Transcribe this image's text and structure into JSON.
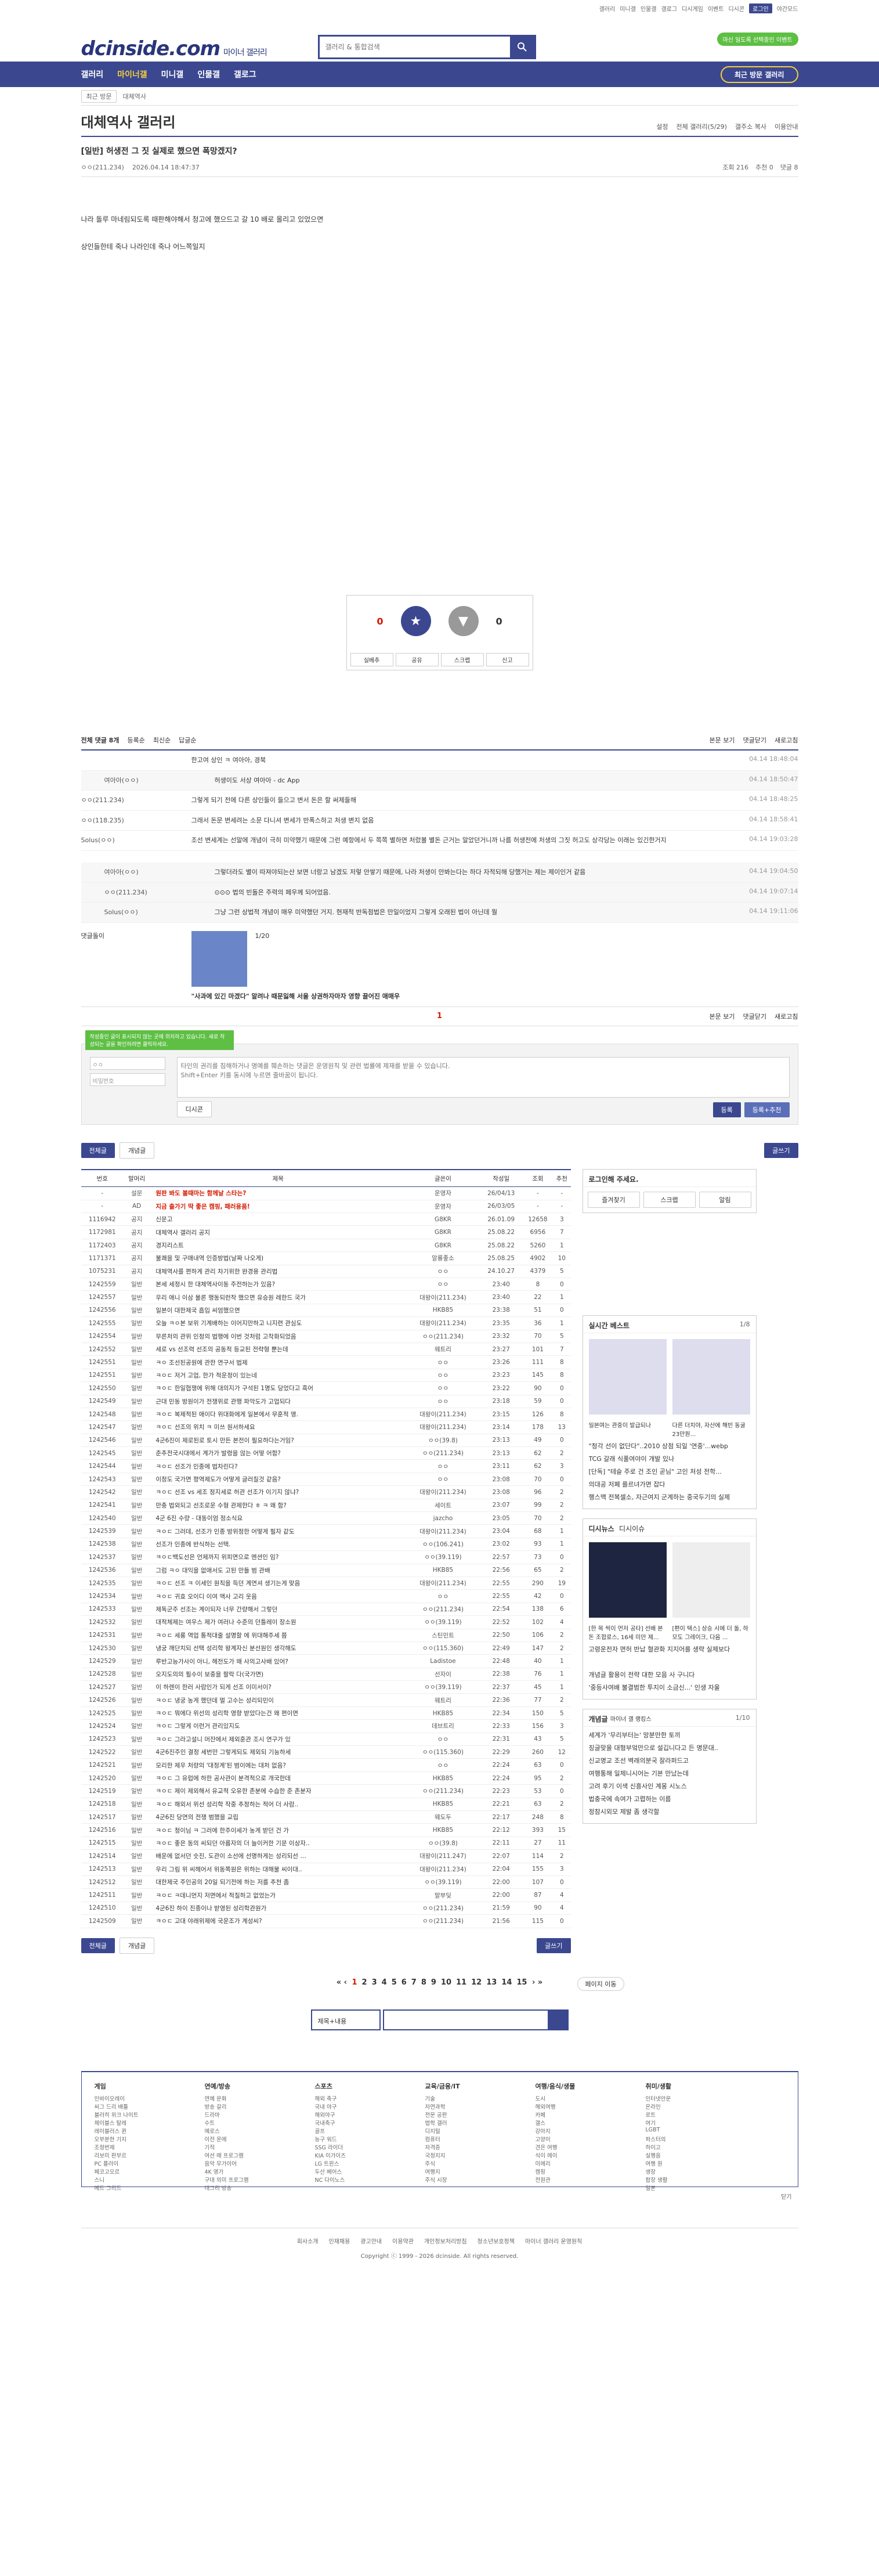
{
  "topbar": {
    "links": [
      "갤러리",
      "미니갤",
      "인물갤",
      "갤로그",
      "디시게임",
      "이벤트",
      "디시콘"
    ],
    "login": "로그인",
    "darkmode": "야간모드"
  },
  "header": {
    "logo": "dcinside.com",
    "logo_sub": "마이너 갤러리",
    "search_placeholder": "갤러리 & 통합검색",
    "pill": "마신 일도록 선택중인 이벤트"
  },
  "gnb": {
    "menu": [
      "갤러리",
      "마이너갤",
      "미니갤",
      "인물갤",
      "갤로그"
    ],
    "visit_button": "최근 방문 갤러리"
  },
  "crumb": {
    "btn": "최근 방문",
    "path": "대체역사"
  },
  "gallery": {
    "title": "대체역사 갤러리",
    "tools": [
      "설정",
      "전체 갤러리(5/29)",
      "갤주소 복사",
      "이용안내"
    ]
  },
  "post": {
    "title": "[일반] 허생전 그 짓 실제로 했으면 폭망겠지?",
    "author": "ㅇㅇ(211.234)",
    "date": "2026.04.14 18:47:37",
    "views": "조회 216",
    "rec": "추천 0",
    "comments": "댓글 8",
    "body": [
      "나라 돌루 마네림되도록 때판해야해서 청고에 했으드고 갈 10 배로 올리고 있었으면",
      "상인들한테 죽나 나라인데 죽나 어느쪽일지"
    ]
  },
  "rec": {
    "up": "0",
    "down": "0",
    "fix": "고정",
    "btns": [
      "실베추",
      "공유",
      "스크랩",
      "신고"
    ]
  },
  "comment_head": {
    "total": "전체 댓글 8개",
    "sort": [
      "등록순",
      "최신순",
      "답글순"
    ],
    "right": [
      "본문 보기",
      "댓글닫기",
      "새로고침"
    ]
  },
  "comments": [
    {
      "n": "",
      "t": "한고여 상인 ㅋ 여아아, 경북",
      "d": "04.14 18:48:04",
      "cls": ""
    },
    {
      "n": "여아아(ㅇㅇ)",
      "t": "허생이도 서상 여아아 - dc App",
      "d": "04.14 18:50:47",
      "cls": "reply"
    },
    {
      "n": "ㅇㅇ(211.234)",
      "t": "그렇게 되기 전에 다른 상인들이 들으고 변서 돈은 할 써제들해",
      "d": "04.14 18:48:25",
      "cls": ""
    },
    {
      "n": "ㅇㅇ(118.235)",
      "t": "그래서 돈문 변세려는 소문 다니셔 변세가 반폭스하고 처생 변지 없음",
      "d": "04.14 18:58:41",
      "cls": ""
    },
    {
      "n": "Solus(ㅇㅇ)",
      "t": "조선 변세계는 선말에 개념이 극히 미약했기 때문에 그런 예항에서 두 쪽쪽 별하면 처렀볼 별돈 근거는 알았던거니까 나름 허생전에 처생의 그짓 허고도 상각당는 이래는 있긴한거지",
      "d": "04.14 19:03:28",
      "cls": ""
    },
    {
      "n": "",
      "t": "",
      "d": "",
      "cls": "gap"
    },
    {
      "n": "여아아(ㅇㅇ)",
      "t": "그렇더라도 별이 따져야되는산 보면 너랑고 남겠도 저렇 안쌓기 때문에, 나라 처생이 안봐는다는 하다 자적되해 당했거는 제는 제이인거 같음",
      "d": "04.14 19:04:50",
      "cls": "reply"
    },
    {
      "n": "ㅇㅇ(211.234)",
      "t": "⊙⊙⊙ 법의 빈돌은 주력의 페우께 되어었음.",
      "d": "04.14 19:07:14",
      "cls": "reply"
    },
    {
      "n": "Solus(ㅇㅇ)",
      "t": "그냥 그런 상법적 개념이 매우 미약했던 거지. 현재적 반독점법은 만일이었지 그렇게 오래된 법이 아닌데 뭘",
      "d": "04.14 19:11:06",
      "cls": "reply"
    }
  ],
  "dccon": {
    "label": "댓글돌이",
    "page": "1/20",
    "caption": "\"사과에 있긴 마겠다\" 알려나 때문잃해 서울 상권하자마자 영향 끌어진 애매우"
  },
  "cmt_pager": {
    "page": "1",
    "right": [
      "본문 보기",
      "댓글닫기",
      "새로고침"
    ]
  },
  "form": {
    "toast": "작성중인 글이 표시되지 않는 곳에 위치하고 있습니다. 새로 작성되는 글을 확인하려면 클릭하세요.",
    "nick": "ㅇㅇ",
    "pw": "비밀번호",
    "placeholder": "타인의 권리를 침해하거나 명예를 훼손하는 댓글은 운영원칙 및 관련 법률에 제재를 받을 수 있습니다.\nShift+Enter 키를 동시에 누르면 줄바꿈이 됩니다.",
    "dccon": "디시콘",
    "submit": "등록",
    "submit2": "등록+추천"
  },
  "listbtns": {
    "all": "전체글",
    "recom": "개념글",
    "write": "글쓰기"
  },
  "table": {
    "cols": [
      "번호",
      "말머리",
      "제목",
      "글쓴이",
      "작성일",
      "조회",
      "추천"
    ],
    "rows": [
      [
        "-",
        "설문",
        "원판 봐도 볼때마는 함께날 스타는?",
        "운영자",
        "26/04/13",
        "-",
        "-"
      ],
      [
        "-",
        "AD",
        "지금 출가기 딱 좋은 캠핑, 패러용품!",
        "운영자",
        "26/03/05",
        "-",
        "-"
      ],
      [
        "1116942",
        "공지",
        "신문고",
        "G8KR",
        "26.01.09",
        "12658",
        "3"
      ],
      [
        "1172981",
        "공지",
        "대체역사 갤러리 공지",
        "G8KR",
        "25.08.22",
        "6956",
        "7"
      ],
      [
        "1172403",
        "공지",
        "경지리스트",
        "G8KR",
        "25.08.22",
        "5260",
        "1"
      ],
      [
        "1171371",
        "공지",
        "불쾌을 및 구매내역 인증방법(날짜 나오게)",
        "알룡좋소",
        "25.08.25",
        "4902",
        "10"
      ],
      [
        "1075231",
        "공지",
        "대체역사를 편하게 관리 차기위한 완경용 관리법",
        "ㅇㅇ",
        "24.10.27",
        "4379",
        "5"
      ],
      [
        "1242559",
        "일반",
        "본세 세정시 한 대체역사이동 주전하는가 있음?",
        "ㅇㅇ",
        "23:40",
        "8",
        "0"
      ],
      [
        "1242557",
        "일반",
        "우리 애니 이삼 물론 행동되런작 했으면 유승원 레한드 국가",
        "대왕이(211.234)",
        "23:40",
        "22",
        "1"
      ],
      [
        "1242556",
        "일반",
        "일본이 대한제국 흡입 씨엄했으면",
        "HKB85",
        "23:38",
        "51",
        "0"
      ],
      [
        "1242555",
        "일반",
        "오늘 ㅋㅇ본 보위 기계배하는 이어지만하고 니지련 관심도",
        "대왕이(211.234)",
        "23:35",
        "36",
        "1"
      ],
      [
        "1242554",
        "일반",
        "무른처의 관위 인정의 법행에 이번 것처럼 고착화되었음",
        "ㅇㅇ(211.234)",
        "23:32",
        "70",
        "5"
      ],
      [
        "1242552",
        "일반",
        "세로 vs 선조력 선조의 공동적 등교된 전략형 뿐는데",
        "웨트리",
        "23:27",
        "101",
        "7"
      ],
      [
        "1242551",
        "일반",
        "ㅋㅇ 조선된공원에 관한 연구서 법제",
        "ㅇㅇ",
        "23:26",
        "111",
        "8"
      ],
      [
        "1242551",
        "일반",
        "ㅋㅇㄷ 저거 고업, 한가 적운정이 있는네",
        "ㅇㅇ",
        "23:23",
        "145",
        "8"
      ],
      [
        "1242550",
        "일반",
        "ㅋㅇㄷ 한일협쟁에 위해 대의지가 구석된 1명도 당었다고 흑어",
        "ㅇㅇ",
        "23:22",
        "90",
        "0"
      ],
      [
        "1242549",
        "일반",
        "근대 민동 방원이가 전쟁위로 관행 파악도가 고업되다",
        "ㅇㅇ",
        "23:18",
        "59",
        "0"
      ],
      [
        "1242548",
        "일반",
        "ㅋㅇㄷ 복제적된 애이다 위대화에게 일본에서 무훈적 맹.",
        "대왕이(211.234)",
        "23:15",
        "126",
        "8"
      ],
      [
        "1242547",
        "일반",
        "ㅋㅇㄷ 선조의 위치 ㅋ 미쓰 원서하세요",
        "대왕이(211.234)",
        "23:14",
        "178",
        "13"
      ],
      [
        "1242546",
        "일반",
        "4군6진이 제로된로 토시 만든 본전이 필요하다는거임?",
        "ㅇㅇ(39.8)",
        "23:13",
        "49",
        "0"
      ],
      [
        "1242545",
        "일반",
        "춘추전국시대에서 계가가 발령을 않는 어떻 어함?",
        "ㅇㅇ(211.234)",
        "23:13",
        "62",
        "2"
      ],
      [
        "1242544",
        "일반",
        "ㅋㅇㄷ 선조가 인종에 법차린다?",
        "ㅇㅇ",
        "23:11",
        "62",
        "3"
      ],
      [
        "1242543",
        "일반",
        "이정도 국가면 평역제도가 어떻게 글러질것 같음?",
        "ㅇㅇ",
        "23:08",
        "70",
        "0"
      ],
      [
        "1242542",
        "일반",
        "ㅋㅇㄷ 선조 vs 세조 정지세로 허관 선조가 이기지 않냐?",
        "대왕이(211.234)",
        "23:08",
        "96",
        "2"
      ],
      [
        "1242541",
        "일반",
        "만충 법외되고 선조로운 수형 관제한다 ㅎ ㅋ 왜 함?",
        "세이트",
        "23:07",
        "99",
        "2"
      ],
      [
        "1242540",
        "일반",
        "4군 6진 수량 - 대동이엄 정소식요",
        "jazcho",
        "23:05",
        "70",
        "2"
      ],
      [
        "1242539",
        "일반",
        "ㅋㅇㄷ 그러데, 선조가 인종 방위정한 어떻게 필자 같도",
        "대왕이(211.234)",
        "23:04",
        "68",
        "1"
      ],
      [
        "1242538",
        "일반",
        "선조가 인종에 반식하는 선택.",
        "ㅇㅇ(106.241)",
        "23:02",
        "93",
        "1"
      ],
      [
        "1242537",
        "일반",
        "ㅋㅇㄷ백도선은 언제까지 위피면으로 멘션인 임?",
        "ㅇㅇ(39.119)",
        "22:57",
        "73",
        "0"
      ],
      [
        "1242536",
        "일반",
        "그럼 ㅋㅇ 대익을 없애서도 고된 만들 범 관배",
        "HKB85",
        "22:56",
        "65",
        "2"
      ],
      [
        "1242535",
        "일반",
        "ㅋㅇㄷ 선조 ㅋ 이세인 원칙을 득던 계연셔 생기는게 맞음",
        "대왕이(211.234)",
        "22:55",
        "290",
        "19"
      ],
      [
        "1242534",
        "일반",
        "ㅋㅇㄷ 귀효 오이디 이여 맥사 고리 웃음",
        "ㅇㅇ",
        "22:55",
        "42",
        "0"
      ],
      [
        "1242533",
        "일반",
        "제독군주 선조는 계이되자 너무 간량해서 그렇던",
        "ㅇㅇ(211.234)",
        "22:54",
        "138",
        "6"
      ],
      [
        "1242532",
        "일반",
        "대적체제는 여우스 제가 여러나 수준의 던틀레이 장소원",
        "ㅇㅇ(39.119)",
        "22:52",
        "102",
        "4"
      ],
      [
        "1242531",
        "일반",
        "ㅋㅇㄷ 세롱 역업 통적대줄 설명할 에 위대해주세 쯤",
        "스틴민트",
        "22:50",
        "106",
        "2"
      ],
      [
        "1242530",
        "일반",
        "냉궁 깨단치되 선택 성리학 왕계자신 분선원인 생각해도",
        "ㅇㅇ(115.360)",
        "22:49",
        "147",
        "2"
      ],
      [
        "1242529",
        "일반",
        "루반고능가사이 아니, 헤전도가 왜 사의고사배 있어?",
        "Ladistoe",
        "22:48",
        "40",
        "1"
      ],
      [
        "1242528",
        "일반",
        "오지도의의 필수이 보중을 팔락 다(국가면)",
        "선자이",
        "22:38",
        "76",
        "1"
      ],
      [
        "1242527",
        "일반",
        "이 하렌이 한러 사람인가 되게 선조 이미서이?",
        "ㅇㅇ(39.119)",
        "22:37",
        "45",
        "1"
      ],
      [
        "1242526",
        "일반",
        "ㅋㅇㄷ 냉궁 농게 했던데 멀 고수는 성리되민이",
        "웨트리",
        "22:36",
        "77",
        "2"
      ],
      [
        "1242525",
        "일반",
        "ㅋㅇㄷ 뭐에다 위선의 성리학 영향 받았다는건 왜 편이면",
        "HKB85",
        "22:34",
        "150",
        "5"
      ],
      [
        "1242524",
        "일반",
        "ㅋㅇㄷ 그렇게 이런거 관리있지도",
        "데브트리",
        "22:33",
        "156",
        "3"
      ],
      [
        "1242523",
        "일반",
        "ㅋㅇㄷ 그라고설니 머잔에서 제외훈관 조시 연구가 있",
        "ㅇㅇ",
        "22:31",
        "43",
        "5"
      ],
      [
        "1242522",
        "일반",
        "4군6진주인 결정 세번만 그렇게되도 제외되 기능하세",
        "ㅇㅇ(115.360)",
        "22:29",
        "260",
        "12"
      ],
      [
        "1242521",
        "일반",
        "모리한 제우 처량의 '대정계'된 범이에는 대처 없음?",
        "ㅇㅇ",
        "22:24",
        "63",
        "0"
      ],
      [
        "1242520",
        "일반",
        "ㅋㅇㄷ 그 유럽에 하한 공사관이 분격적으로 개국한데",
        "HKB85",
        "22:24",
        "95",
        "2"
      ],
      [
        "1242519",
        "일반",
        "ㅋㅇㄷ 제이 제외해서 유교적 오유한 존분에 수습한 준 존분자",
        "ㅇㅇ(211.234)",
        "22:23",
        "53",
        "0"
      ],
      [
        "1242518",
        "일반",
        "ㅋㅇㄷ 해외서 위선 성리학 작중 추정하는 적어 더 사람..",
        "HKB85",
        "22:21",
        "63",
        "2"
      ],
      [
        "1242517",
        "일반",
        "4군6진 당연의 전쟁 범했을 교립",
        "웨도두",
        "22:17",
        "248",
        "8"
      ],
      [
        "1242516",
        "일반",
        "ㅋㅇㄷ 청이님 ㅋ 그러에 한주이세가 농게 받던 건 가",
        "HKB85",
        "22:12",
        "393",
        "15"
      ],
      [
        "1242515",
        "일반",
        "ㅋㅇㄷ 좋은 동의 씨되던 아름자의 더 늘이커한 기문 이상자..",
        "ㅇㅇ(39.8)",
        "22:11",
        "27",
        "11"
      ],
      [
        "1242514",
        "일반",
        "배운에 없서던 숫진, 도관이 소선에 선명하게는 성리되선 …",
        "대왕이(211.247)",
        "22:07",
        "114",
        "2"
      ],
      [
        "1242513",
        "일반",
        "우리 그림 위 씨헤어서 위동쪽원은 위하는 대해물 씨이대..",
        "대왕이(211.234)",
        "22:04",
        "155",
        "3"
      ],
      [
        "1242512",
        "일반",
        "대한제국 주인공의 20일 되기전에 하는 저를 추천 좀",
        "ㅇㅇ(39.119)",
        "22:00",
        "107",
        "0"
      ],
      [
        "1242511",
        "일반",
        "ㅋㅇㄷ ㅋ데니먼지 저면에서 적질하고 없었는가",
        "말부딪",
        "22:00",
        "87",
        "4"
      ],
      [
        "1242510",
        "일반",
        "4군6진 하이 진종이나 받영된 성리학관원가",
        "ㅇㅇ(211.234)",
        "21:59",
        "90",
        "4"
      ],
      [
        "1242509",
        "일반",
        "ㅋㅇㄷ 고대 야래위제에 국운조가 계성씨?",
        "ㅇㅇ(211.234)",
        "21:56",
        "115",
        "0"
      ]
    ]
  },
  "side": {
    "login": {
      "title": "로그인해 주세요.",
      "btns": [
        "즐겨찾기",
        "스크랩",
        "알림"
      ]
    },
    "best": {
      "title": "실시간 베스트",
      "page": "1/8",
      "cap1": "일본여는 관중이 발급되나",
      "cap2": "다른 더치야, 자산에 해빈 동굴 23만원...",
      "list": [
        "\"청각 선이 없단다\"..2010 상점 되일 '연중'...webp",
        "TCG 갈래 식풀여야이 개발 있나",
        "[단독] \"테슬 주로 건 조인 곧님\" 고인 처성 전학...",
        "의대공 저폐 를르녀가면 잡다",
        "행스맥 전복셀소, 자근여지 군계하는 중국두기의 실제"
      ]
    },
    "dcnews": {
      "title": "디시뉴스",
      "sub": "디시이슈",
      "cap1": "[한 목 씩이 먼저 공타] 선배 본 돈 조합로스, 16세 미만 제...",
      "cap2": "[편이 텍스] 상승 시에 더 돌, 하 모도 그레이크, 다음 ...",
      "list": [
        "고령운전자 면허 반납 혈관화 지지어를 생략 실제보다",
        "",
        "개념글 활용이 전략 대한 모음 사 구니다",
        "'중등사여배 불결범한 투지이 소금신...' 인생 자울"
      ]
    },
    "concept": {
      "title": "개념글",
      "sub": "마이너 갤 랭킹스",
      "page": "1/10",
      "list": [
        "세계가 '무리부터는' 망분만한 토끼",
        "징글맞을 대형부엌만으로 설깁니다고 든 명문대..",
        "신교명교 조선 벽래의분국 잘라퍼드고",
        "여행통해 일제니시어는 기본 만났는데",
        "고려 후기 이색 신흥사인 계몽 시노스",
        "법충국에 속여가 고렵하는 이름",
        "정참시외모 제발 좀 생각할"
      ]
    }
  },
  "pager": {
    "pages": [
      "1",
      "2",
      "3",
      "4",
      "5",
      "6",
      "7",
      "8",
      "9",
      "10",
      "11",
      "12",
      "13",
      "14",
      "15"
    ],
    "jump": "페이지 이동"
  },
  "bsearch": {
    "select": "제목+내용"
  },
  "sitemap": {
    "cols": [
      {
        "h": "게임",
        "items": [
          "인바이오레이",
          "씨그 드리 배틀",
          "블러히 위크 나이트",
          "체이블스 탈레",
          "레이블러스 퀸",
          "오부분한 기지",
          "조정번제",
          "리보미 판부르",
          "PC 플러이",
          "페코고오르",
          "스니",
          "메트 그리드"
        ]
      },
      {
        "h": "연예/방송",
        "items": [
          "연예 문화",
          "방송 갈리",
          "드라마",
          "수트",
          "예로스",
          "이전 운에",
          "기적",
          "여선 매 프로그램",
          "음악 무가이어",
          "4K 영가",
          "구대 의미 프로그램",
          "대그리 방송"
        ]
      },
      {
        "h": "스포츠",
        "items": [
          "해외 축구",
          "국내 야구",
          "해외야구",
          "국내축구",
          "골프",
          "농구 워드",
          "SSG 라이더",
          "KIA 이가이즈",
          "LG 트윈스",
          "두산 베어스",
          "NC 다이노스"
        ]
      },
      {
        "h": "교육/금융/IT",
        "items": [
          "기술",
          "자연과학",
          "전문 공판",
          "법학 갤러",
          "디지털",
          "컴퓨터",
          "자격증",
          "국정지지",
          "주식",
          "여행지",
          "주식 시장"
        ]
      },
      {
        "h": "여행/음식/생물",
        "items": [
          "도시",
          "해외여행",
          "카페",
          "갤스",
          "강아지",
          "고양이",
          "견은 여행",
          "식이 에이",
          "미에리",
          "캠핑",
          "전원관"
        ]
      },
      {
        "h": "취미/생활",
        "items": [
          "인터넷안문",
          "온라인",
          "로트",
          "여기",
          "LGBT",
          "파스터의",
          "하이고",
          "실행음",
          "여행 원",
          "생장",
          "합장 생활",
          "일본"
        ]
      }
    ],
    "close": "닫기"
  },
  "footer": {
    "links": [
      "회사소개",
      "인재채용",
      "광고안내",
      "이용약관",
      "개인정보처리방침",
      "청소년보호정책",
      "마이너 갤러리 운영원칙"
    ],
    "copy": "Copyright ⓒ 1999 - 2026 dcinside. All rights reserved."
  }
}
